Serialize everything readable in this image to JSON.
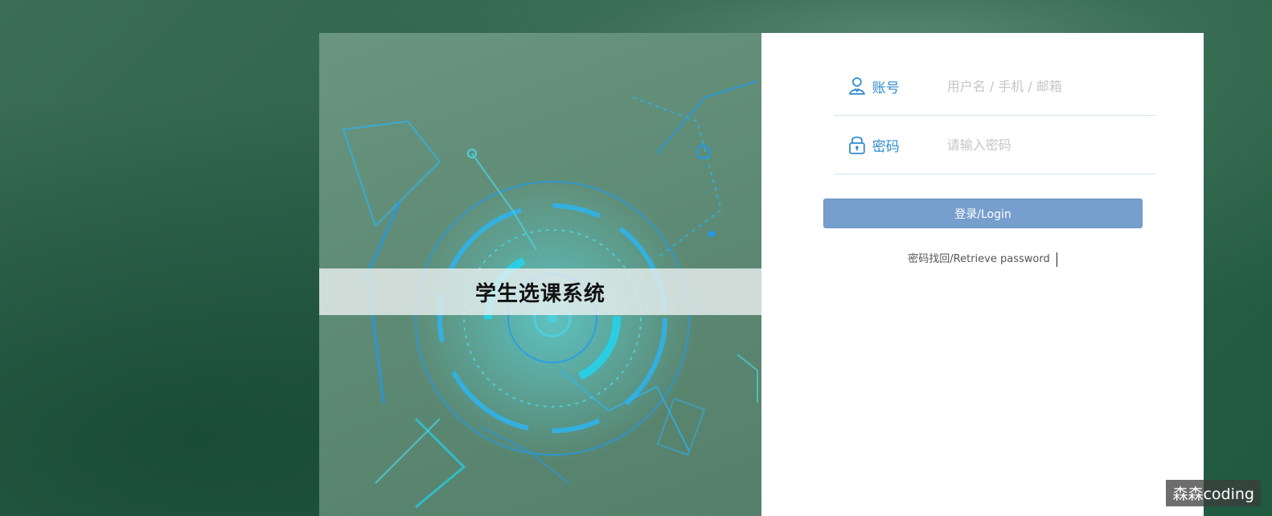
{
  "app": {
    "system_title": "学生选课系统"
  },
  "form": {
    "account": {
      "icon": "user-icon",
      "label": "账号",
      "placeholder": "用户名 / 手机 / 邮箱",
      "value": ""
    },
    "password": {
      "icon": "lock-icon",
      "label": "密码",
      "placeholder": "请输入密码",
      "value": ""
    },
    "login_button": "登录/Login",
    "retrieve_link": "密码找回/Retrieve password"
  },
  "watermark": "森森coding",
  "colors": {
    "accent": "#2e8bd1",
    "button": "#769fcd",
    "background": "#2c6049",
    "panel_left": "#5d8a74",
    "tech_glow": "#22d3ee"
  }
}
